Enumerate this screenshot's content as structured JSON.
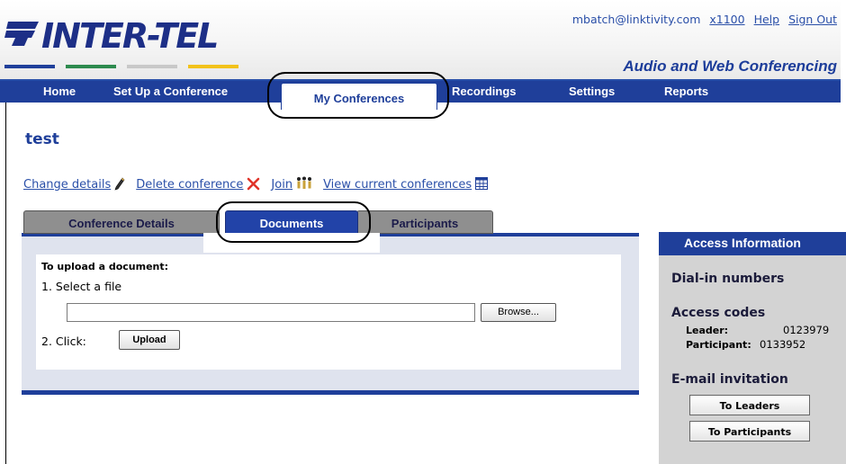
{
  "header": {
    "logo_text": "INTER-TEL",
    "email": "mbatch@linktivity.com",
    "extension": "x1100",
    "help": "Help",
    "sign_out": "Sign Out",
    "subtitle": "Audio and Web Conferencing"
  },
  "nav": {
    "items": [
      "Home",
      "Set Up a Conference",
      "My Conferences",
      "Recordings",
      "Settings",
      "Reports"
    ],
    "active": "My Conferences"
  },
  "page": {
    "title": "test",
    "actions": [
      "Change details",
      "Delete conference",
      "Join",
      "View current conferences"
    ]
  },
  "subtabs": {
    "items": [
      "Conference Details",
      "Documents",
      "Participants"
    ],
    "active": "Documents"
  },
  "upload": {
    "heading": "To upload a document:",
    "step1": "1. Select a file",
    "file_value": "",
    "browse_label": "Browse...",
    "step2": "2. Click:",
    "upload_label": "Upload"
  },
  "access": {
    "header": "Access Information",
    "dial_in": "Dial-in numbers",
    "access_codes": "Access codes",
    "leader_label": "Leader:",
    "leader_code": "0123979",
    "participant_label": "Participant:",
    "participant_code": "0133952",
    "email_invitation": "E-mail invitation",
    "to_leaders": "To Leaders",
    "to_participants": "To Participants"
  },
  "colors": {
    "brand_blue": "#1f3f9a",
    "logo_bar_1": "#1f3f9a",
    "logo_bar_2": "#2d8a4e",
    "logo_bar_3": "#c8c8c8",
    "logo_bar_4": "#f2c21b",
    "delete_icon": "#e0342a"
  }
}
